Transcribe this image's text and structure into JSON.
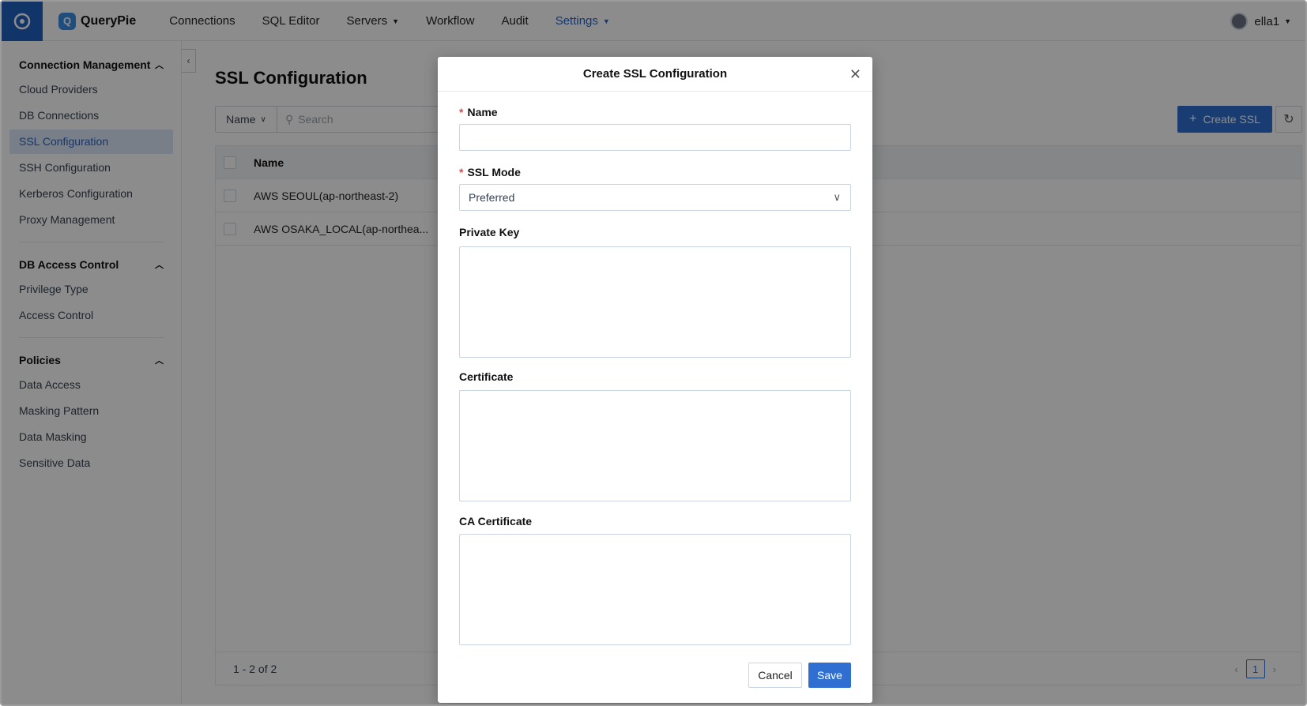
{
  "app": {
    "brand": "QueryPie"
  },
  "nav": {
    "items": [
      "Connections",
      "SQL Editor",
      "Servers",
      "Workflow",
      "Audit",
      "Settings"
    ],
    "user": "ella1"
  },
  "sidebar": {
    "groups": [
      {
        "title": "Connection Management",
        "items": [
          "Cloud Providers",
          "DB Connections",
          "SSL Configuration",
          "SSH Configuration",
          "Kerberos Configuration",
          "Proxy Management"
        ]
      },
      {
        "title": "DB Access Control",
        "items": [
          "Privilege Type",
          "Access Control"
        ]
      },
      {
        "title": "Policies",
        "items": [
          "Data Access",
          "Masking Pattern",
          "Data Masking",
          "Sensitive Data"
        ]
      }
    ]
  },
  "main": {
    "title": "SSL Configuration",
    "filter_select": "Name",
    "search_placeholder": "Search",
    "create_button": "Create SSL",
    "table": {
      "header": "Name",
      "rows": [
        "AWS SEOUL(ap-northeast-2)",
        "AWS OSAKA_LOCAL(ap-northea..."
      ],
      "footer": "1 - 2 of 2",
      "page": "1"
    }
  },
  "modal": {
    "title": "Create SSL Configuration",
    "name_label": "Name",
    "ssl_mode_label": "SSL Mode",
    "ssl_mode_value": "Preferred",
    "private_key_label": "Private Key",
    "certificate_label": "Certificate",
    "ca_certificate_label": "CA Certificate",
    "cancel": "Cancel",
    "save": "Save"
  },
  "colors": {
    "accent": "#2e6fd1",
    "required": "#e5484d"
  }
}
